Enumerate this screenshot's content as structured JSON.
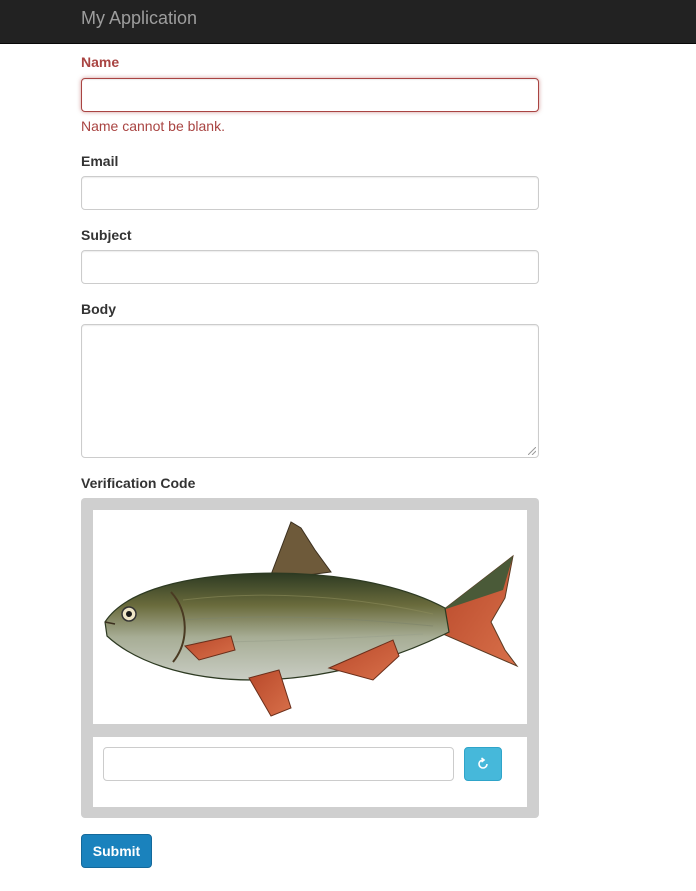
{
  "navbar": {
    "brand": "My Application"
  },
  "form": {
    "name": {
      "label": "Name",
      "value": "",
      "error": "Name cannot be blank."
    },
    "email": {
      "label": "Email",
      "value": ""
    },
    "subject": {
      "label": "Subject",
      "value": ""
    },
    "body": {
      "label": "Body",
      "value": ""
    },
    "verification": {
      "label": "Verification Code",
      "image": "fish-captcha-image",
      "input_value": "",
      "refresh_icon": "refresh-icon"
    },
    "submit_label": "Submit"
  },
  "colors": {
    "navbar_bg": "#222222",
    "error": "#a94442",
    "primary_button": "#1a82bd",
    "info_button": "#46b8da",
    "captcha_panel": "#cfcfcf"
  }
}
